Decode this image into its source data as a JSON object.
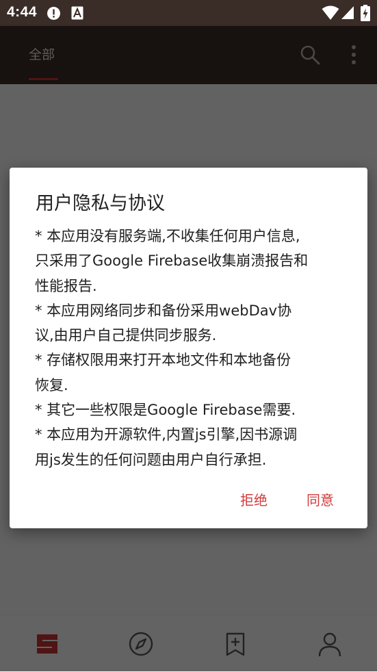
{
  "status_bar": {
    "time": "4:44",
    "icons": [
      "alert-circle-icon",
      "font-a-icon",
      "wifi-icon",
      "signal-icon",
      "battery-charging-icon"
    ]
  },
  "app_bar": {
    "tab_all": "全部",
    "icons": [
      "search-icon",
      "more-vert-icon"
    ]
  },
  "dialog": {
    "title": "用户隐私与协议",
    "paragraphs": [
      "* 本应用没有服务端,不收集任何用户信息,\n只采用了Google Firebase收集崩溃报告和\n性能报告.",
      "* 本应用网络同步和备份采用webDav协\n议,由用户自己提供同步服务.",
      "* 存储权限用来打开本地文件和本地备份\n恢复.",
      "* 其它一些权限是Google Firebase需要.",
      "* 本应用为开源软件,内置js引擎,因书源调\n用js发生的任何问题由用户自行承担."
    ],
    "refuse_label": "拒绝",
    "agree_label": "同意"
  },
  "bottom_nav": {
    "items": [
      "bookshelf-icon",
      "compass-icon",
      "bookmark-add-icon",
      "person-icon"
    ]
  },
  "colors": {
    "status_bar": "#3a2c27",
    "accent": "#c93232",
    "dialog_button": "#d23a3a"
  }
}
